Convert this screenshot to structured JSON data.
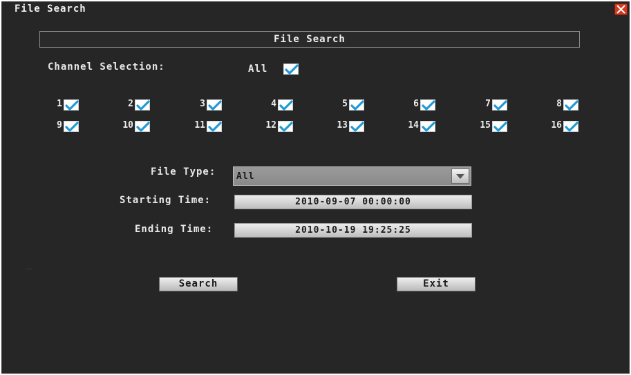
{
  "window": {
    "title": "File Search"
  },
  "section": {
    "header": "File Search"
  },
  "channel_selection": {
    "label": "Channel Selection:",
    "all_label": "All",
    "all_checked": true,
    "channels": [
      {
        "label": "1",
        "checked": true
      },
      {
        "label": "2",
        "checked": true
      },
      {
        "label": "3",
        "checked": true
      },
      {
        "label": "4",
        "checked": true
      },
      {
        "label": "5",
        "checked": true
      },
      {
        "label": "6",
        "checked": true
      },
      {
        "label": "7",
        "checked": true
      },
      {
        "label": "8",
        "checked": true
      },
      {
        "label": "9",
        "checked": true
      },
      {
        "label": "10",
        "checked": true
      },
      {
        "label": "11",
        "checked": true
      },
      {
        "label": "12",
        "checked": true
      },
      {
        "label": "13",
        "checked": true
      },
      {
        "label": "14",
        "checked": true
      },
      {
        "label": "15",
        "checked": true
      },
      {
        "label": "16",
        "checked": true
      }
    ]
  },
  "file_type": {
    "label": "File Type:",
    "value": "All"
  },
  "starting_time": {
    "label": "Starting Time:",
    "value": "2010-09-07 00:00:00"
  },
  "ending_time": {
    "label": "Ending Time:",
    "value": "2010-10-19 19:25:25"
  },
  "buttons": {
    "search": "Search",
    "exit": "Exit"
  },
  "colors": {
    "background": "#262626",
    "check": "#1e9ad6",
    "close": "#d23a1e"
  }
}
